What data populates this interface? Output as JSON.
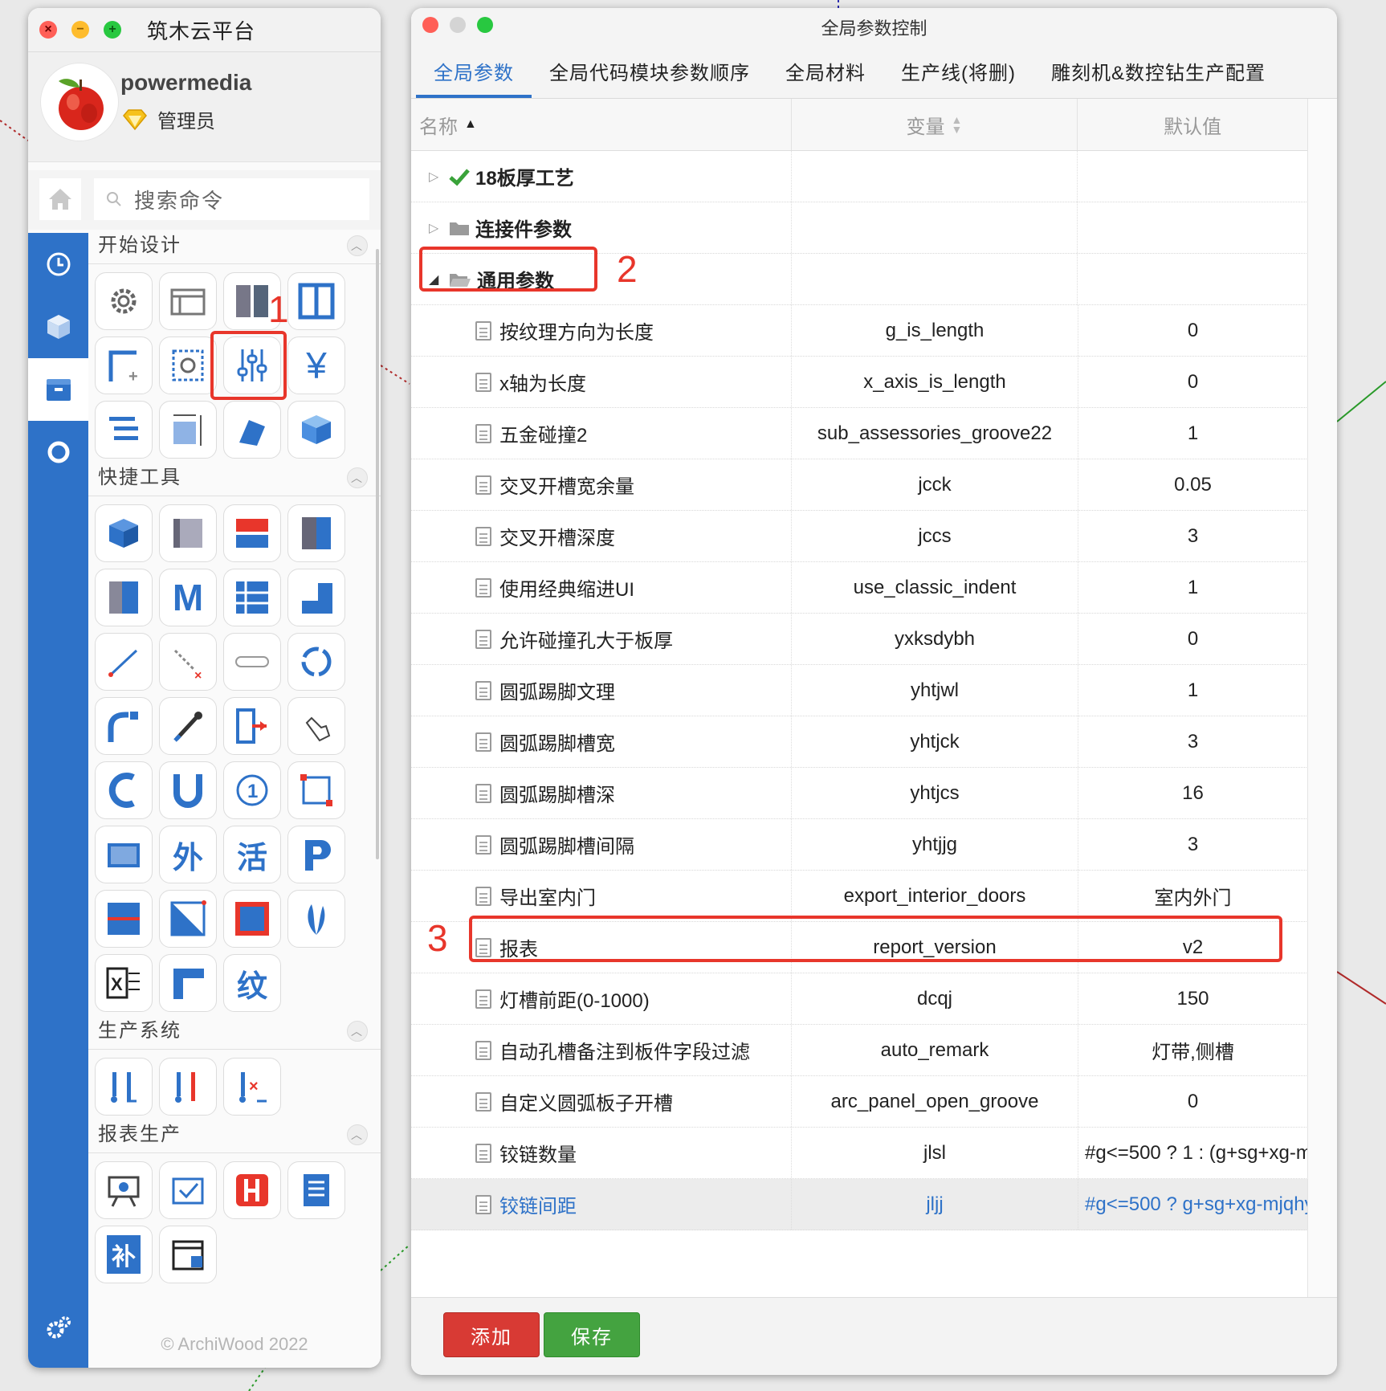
{
  "left_panel": {
    "app_title": "筑木云平台",
    "user": {
      "name": "powermedia",
      "role": "管理员"
    },
    "search_placeholder": "搜索命令",
    "sections": {
      "start_design": "开始设计",
      "quick_tools": "快捷工具",
      "production_system": "生产系统",
      "report_production": "报表生产"
    },
    "quick_tool_glyphs": [
      "M",
      "外",
      "活",
      "纹",
      "补"
    ],
    "copyright": "© ArchiWood 2022"
  },
  "window": {
    "title": "全局参数控制",
    "tabs": [
      "全局参数",
      "全局代码模块参数顺序",
      "全局材料",
      "生产线(将删)",
      "雕刻机&数控钻生产配置"
    ],
    "active_tab": 0,
    "columns": [
      "名称",
      "变量",
      "默认值"
    ],
    "groups": [
      {
        "name": "18板厚工艺",
        "expanded": false,
        "icon": "check-icon"
      },
      {
        "name": "连接件参数",
        "expanded": false,
        "icon": "folder-icon"
      },
      {
        "name": "通用参数",
        "expanded": true,
        "icon": "open-folder-icon"
      }
    ],
    "rows": [
      {
        "name": "按纹理方向为长度",
        "var": "g_is_length",
        "default": "0"
      },
      {
        "name": "x轴为长度",
        "var": "x_axis_is_length",
        "default": "0"
      },
      {
        "name": "五金碰撞2",
        "var": "sub_assessories_groove22",
        "default": "1"
      },
      {
        "name": "交叉开槽宽余量",
        "var": "jcck",
        "default": "0.05"
      },
      {
        "name": "交叉开槽深度",
        "var": "jccs",
        "default": "3"
      },
      {
        "name": "使用经典缩进UI",
        "var": "use_classic_indent",
        "default": "1"
      },
      {
        "name": "允许碰撞孔大于板厚",
        "var": "yxksdybh",
        "default": "0"
      },
      {
        "name": "圆弧踢脚文理",
        "var": "yhtjwl",
        "default": "1"
      },
      {
        "name": "圆弧踢脚槽宽",
        "var": "yhtjck",
        "default": "3"
      },
      {
        "name": "圆弧踢脚槽深",
        "var": "yhtjcs",
        "default": "16"
      },
      {
        "name": "圆弧踢脚槽间隔",
        "var": "yhtjjg",
        "default": "3"
      },
      {
        "name": "导出室内门",
        "var": "export_interior_doors",
        "default": "室内外门"
      },
      {
        "name": "报表",
        "var": "report_version",
        "default": "v2"
      },
      {
        "name": "灯槽前距(0-1000)",
        "var": "dcqj",
        "default": "150"
      },
      {
        "name": "自动孔槽备注到板件字段过滤",
        "var": "auto_remark",
        "default": "灯带,侧槽"
      },
      {
        "name": "自定义圆弧板子开槽",
        "var": "arc_panel_open_groove",
        "default": "0"
      },
      {
        "name": "铰链数量",
        "var": "jlsl",
        "default": "#g<=500 ? 1 : (g+sg+xg-m"
      },
      {
        "name": "铰链间距",
        "var": "jljj",
        "default": "#g<=500 ? g+sg+xg-mjqhy"
      }
    ],
    "selected_row": 17,
    "buttons": {
      "add": "添加",
      "save": "保存"
    }
  },
  "annotations": [
    "1",
    "2",
    "3"
  ],
  "colors": {
    "accent": "#2e72c8",
    "annotation": "#e8362b",
    "add": "#d83a34",
    "save": "#44a340"
  }
}
